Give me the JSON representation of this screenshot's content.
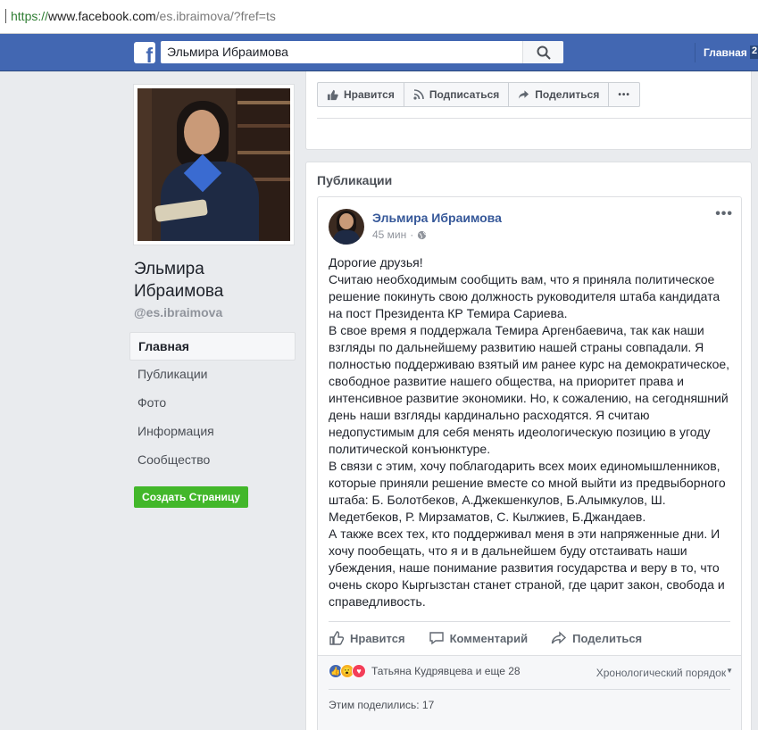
{
  "browser": {
    "url_proto": "https://",
    "url_host": "www.facebook.com",
    "url_path": "/es.ibraimova/?fref=ts"
  },
  "topbar": {
    "logo_letter": "f",
    "search_value": "Эльмира Ибраимова",
    "home_label": "Главная",
    "badge": "2"
  },
  "profile": {
    "name": "Эльмира Ибраимова",
    "handle": "@es.ibraimova"
  },
  "nav": {
    "items": [
      "Главная",
      "Публикации",
      "Фото",
      "Информация",
      "Сообщество"
    ],
    "create_page": "Создать Страницу"
  },
  "actions": {
    "like": "Нравится",
    "follow": "Подписаться",
    "share": "Поделиться",
    "more": "•••"
  },
  "publications": {
    "title": "Публикации",
    "post": {
      "author": "Эльмира Ибраимова",
      "time": "45 мин",
      "text": "Дорогие друзья!\nСчитаю необходимым сообщить вам, что я приняла политическое решение покинуть свою должность руководителя штаба кандидата на пост Президента КР Темира Сариева.\nВ свое время я поддержала Темира Аргенбаевича, так как наши взгляды по дальнейшему развитию нашей страны совпадали. Я полностью поддерживаю взятый им ранее курс на демократическое, свободное развитие нашего общества, на приоритет права и интенсивное развитие экономики. Но, к сожалению, на сегодняшний день наши взгляды кардинально расходятся. Я считаю недопустимым для себя менять идеологическую позицию в угоду политической конъюнктуре.\nВ связи с этим, хочу поблагодарить всех моих единомышленников, которые приняли решение вместе со мной выйти из предвыборного штаба: Б. Болотбеков, А.Джекшенкулов, Б.Алымкулов, Ш. Медетбеков, Р. Мирзаматов, С. Кылжиев, Б.Джандаев.\nА также всех тех, кто поддерживал меня в эти напряженные дни. И хочу пообещать, что я и в дальнейшем буду отстаивать наши убеждения, наше понимание развития государства и веру в то, что очень скоро Кыргызстан станет страной, где царит закон, свобода и справедливость.",
      "btn_like": "Нравится",
      "btn_comment": "Комментарий",
      "btn_share": "Поделиться",
      "reactions_text": "Татьяна Кудрявцева и еще 28",
      "order": "Хронологический порядок",
      "shares": "Этим поделились: 17"
    }
  },
  "colors": {
    "brand": "#4267b2",
    "link": "#365899",
    "green": "#42b72a"
  }
}
